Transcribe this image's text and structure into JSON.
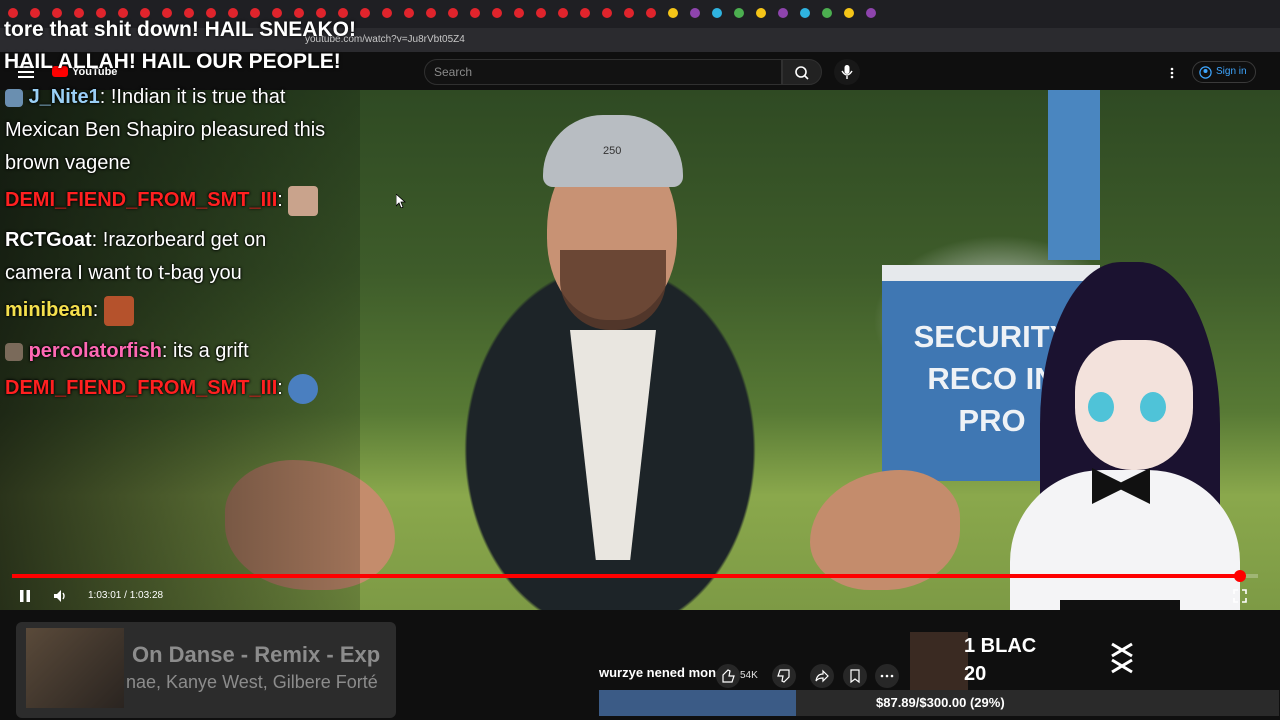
{
  "browser": {
    "url": "youtube.com/watch?v=Ju8rVbt05Z4"
  },
  "youtube": {
    "logo_text": "YouTube",
    "search_placeholder": "Search",
    "sign_in": "Sign in"
  },
  "chat": {
    "top_lines": [
      "tore that shit down! HAIL SNEAKO!",
      "HAIL ALLAH! HAIL OUR PEOPLE!"
    ],
    "messages": [
      {
        "user": "J_Nite1",
        "user_color": "#9ad0f5",
        "text": "!Indian it is true that",
        "cont1": "Mexican Ben Shapiro pleasured this",
        "cont2": "brown vagene"
      },
      {
        "user": "DEMI_FIEND_FROM_SMT_III",
        "user_color": "#ff2020",
        "text": ""
      },
      {
        "user": "RCTGoat",
        "user_color": "#ffffff",
        "text": "!razorbeard get on",
        "cont1": "camera I want to t-bag you"
      },
      {
        "user": "minibean",
        "user_color": "#f4e04d",
        "text": ""
      },
      {
        "user": "percolatorfish",
        "user_color": "#ff69b4",
        "text": "its a grift"
      },
      {
        "user": "DEMI_FIEND_FROM_SMT_III",
        "user_color": "#ff2020",
        "text": ""
      }
    ]
  },
  "video": {
    "sign_text": "SECURITY RECO IN PRO",
    "cap_text": "250"
  },
  "player": {
    "timecode": "1:03:01 / 1:03:28",
    "progress": 0.9858
  },
  "below": {
    "song_title": "On Danse - Remix - Exp",
    "song_artists": "nae, Kanye West, Gilbere Forté",
    "video_title": "wurzye nened money",
    "like_count": "54K",
    "promo": "1 BLAC",
    "promo2": "20",
    "goal_text": "$87.89/$300.00 (29%)",
    "goal_fraction": 0.29
  },
  "colors": {
    "progress": "#ff0000",
    "link": "#3ea6ff",
    "goal_fill": "#3b5b86"
  }
}
